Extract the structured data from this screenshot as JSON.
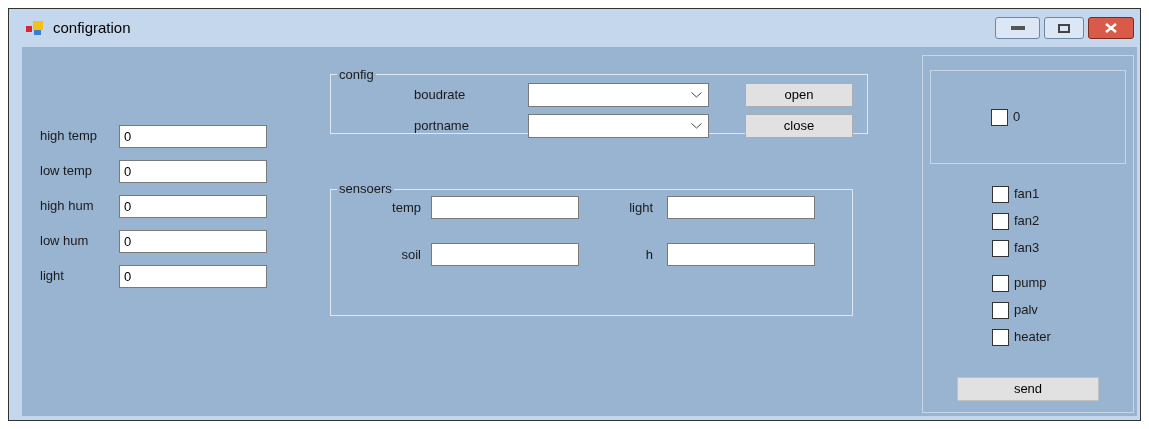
{
  "window": {
    "title": "configration"
  },
  "thresholds": [
    {
      "label": "high temp",
      "value": "0"
    },
    {
      "label": "low temp",
      "value": "0"
    },
    {
      "label": "high hum",
      "value": "0"
    },
    {
      "label": "low hum",
      "value": "0"
    },
    {
      "label": "light",
      "value": "0"
    }
  ],
  "config": {
    "title": "config",
    "fields": [
      {
        "label": "boudrate"
      },
      {
        "label": "portname"
      }
    ],
    "buttons": [
      "open",
      "close"
    ]
  },
  "sensors": {
    "title": "sensoers",
    "fields": [
      {
        "label": "temp"
      },
      {
        "label": "light"
      },
      {
        "label": "soil"
      },
      {
        "label": "h"
      }
    ]
  },
  "right_panel": {
    "top_checkbox": {
      "label": "0",
      "checked": false
    },
    "checkboxes": [
      {
        "label": "fan1",
        "checked": false
      },
      {
        "label": "fan2",
        "checked": false
      },
      {
        "label": "fan3",
        "checked": false
      },
      {
        "label": "pump",
        "checked": false
      },
      {
        "label": "palv",
        "checked": false
      },
      {
        "label": "heater",
        "checked": false
      }
    ],
    "send": "send"
  }
}
